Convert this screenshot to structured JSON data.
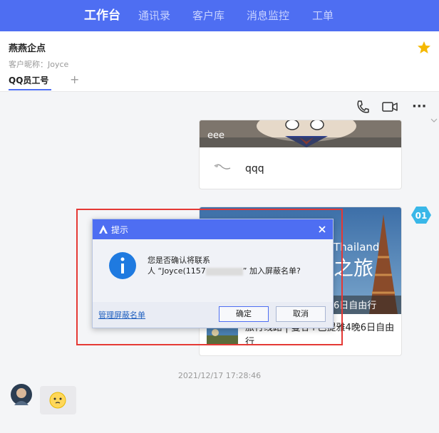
{
  "nav": {
    "items": [
      "工作台",
      "通讯录",
      "客户库",
      "消息监控",
      "工单"
    ],
    "active_index": 0
  },
  "header": {
    "title": "燕燕企点",
    "subtitle": "客户昵称：Joyce",
    "tab": "QQ员工号",
    "plus": "+"
  },
  "toolbar": {
    "more": "···"
  },
  "cards": {
    "top": {
      "image_caption": "eee",
      "text": "qqq"
    },
    "travel": {
      "banner_word": "Thailand",
      "banner_title": "之旅",
      "banner_strip": "6日自由行",
      "text": "旅行线路 | 曼谷+芭提雅4晚6日自由行"
    }
  },
  "agent_badge": "01",
  "timestamp": "2021/12/17 17:28:46",
  "dialog": {
    "title": "提示",
    "message_line1": "您是否确认将联系",
    "message_line2": "人 “Joyce(1157",
    "message_line3": "” 加入屏蔽名单?",
    "manage_link": "管理屏蔽名单",
    "ok": "确定",
    "cancel": "取消"
  },
  "colors": {
    "primary": "#4e6ef2",
    "highlight": "#e53935",
    "star": "#f5b800"
  }
}
